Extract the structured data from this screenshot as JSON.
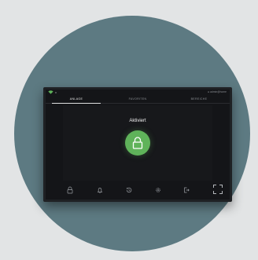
{
  "header": {
    "user_label": "● admin@home"
  },
  "tabs": [
    {
      "label": "ANLAGE"
    },
    {
      "label": "FAVORITEN"
    },
    {
      "label": "BEREICHE"
    }
  ],
  "main": {
    "status_title": "Aktiviert"
  },
  "colors": {
    "backdrop": "#5d7a82",
    "accent_green": "#5fb35a",
    "screen": "#141518"
  },
  "icons": [
    "wifi-icon",
    "lock-icon",
    "bell-icon",
    "history-icon",
    "gear-icon",
    "logout-icon",
    "fullscreen-icon"
  ]
}
